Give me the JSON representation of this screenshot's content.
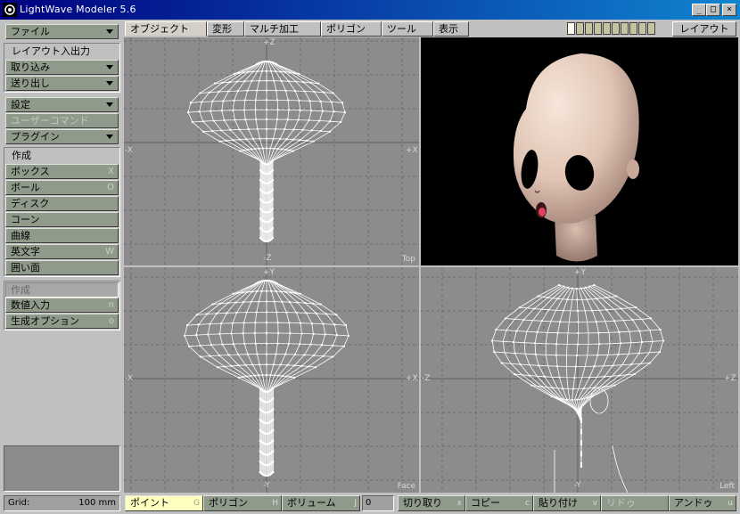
{
  "window": {
    "title": "LightWave Modeler 5.6",
    "btn_min": "_",
    "btn_max": "□",
    "btn_close": "×"
  },
  "tabs": [
    "オブジェクト",
    "変形",
    "マルチ加工",
    "ポリゴン",
    "ツール",
    "表示"
  ],
  "layout_button": "レイアウト",
  "layers": {
    "active_index": 1,
    "count": 10
  },
  "sidebar": {
    "file": "ファイル",
    "layout_io_header": "レイアウト入出力",
    "import": "取り込み",
    "export": "送り出し",
    "settings": "設定",
    "user_command": "ユーザーコマンド",
    "plugin": "プラグイン",
    "create_header": "作成",
    "create_items": [
      {
        "label": "ボックス",
        "key": "X"
      },
      {
        "label": "ボール",
        "key": "O"
      },
      {
        "label": "ディスク",
        "key": ""
      },
      {
        "label": "コーン",
        "key": ""
      },
      {
        "label": "曲線",
        "key": ""
      },
      {
        "label": "英文字",
        "key": "W"
      },
      {
        "label": "囲い面",
        "key": ""
      }
    ],
    "create2_header": "作成",
    "numeric": {
      "label": "数値入力",
      "key": "n"
    },
    "gen_options": {
      "label": "生成オプション",
      "key": "o"
    }
  },
  "viewports": {
    "top": {
      "label": "Top",
      "axis_top": "+Z",
      "axis_bottom": "-Z",
      "axis_left": "-X",
      "axis_right": "+X"
    },
    "face": {
      "label": "Face",
      "axis_top": "+Y",
      "axis_bottom": "-Y",
      "axis_left": "-X",
      "axis_right": "+X"
    },
    "left": {
      "label": "Left",
      "axis_top": "+Y",
      "axis_bottom": "-Y",
      "axis_left": "-Z",
      "axis_right": "+Z"
    }
  },
  "bottom": {
    "grid_label": "Grid:",
    "grid_value": "100 mm",
    "point": {
      "label": "ポイント",
      "key": "G"
    },
    "polygon": {
      "label": "ポリゴン",
      "key": "H"
    },
    "volume": {
      "label": "ボリューム",
      "key": "J"
    },
    "count": "0",
    "cut": {
      "label": "切り取り",
      "key": "x"
    },
    "copy": {
      "label": "コピー",
      "key": "c"
    },
    "paste": {
      "label": "貼り付け",
      "key": "v"
    },
    "redo": {
      "label": "リドゥ",
      "key": ""
    },
    "undo": {
      "label": "アンドゥ",
      "key": "u"
    }
  },
  "colors": {
    "titlebar": "#000080",
    "button": "#8f9a8a",
    "viewport_bg": "#8c8c8c",
    "wire": "#ffffff",
    "perspective_bg": "#000000"
  }
}
